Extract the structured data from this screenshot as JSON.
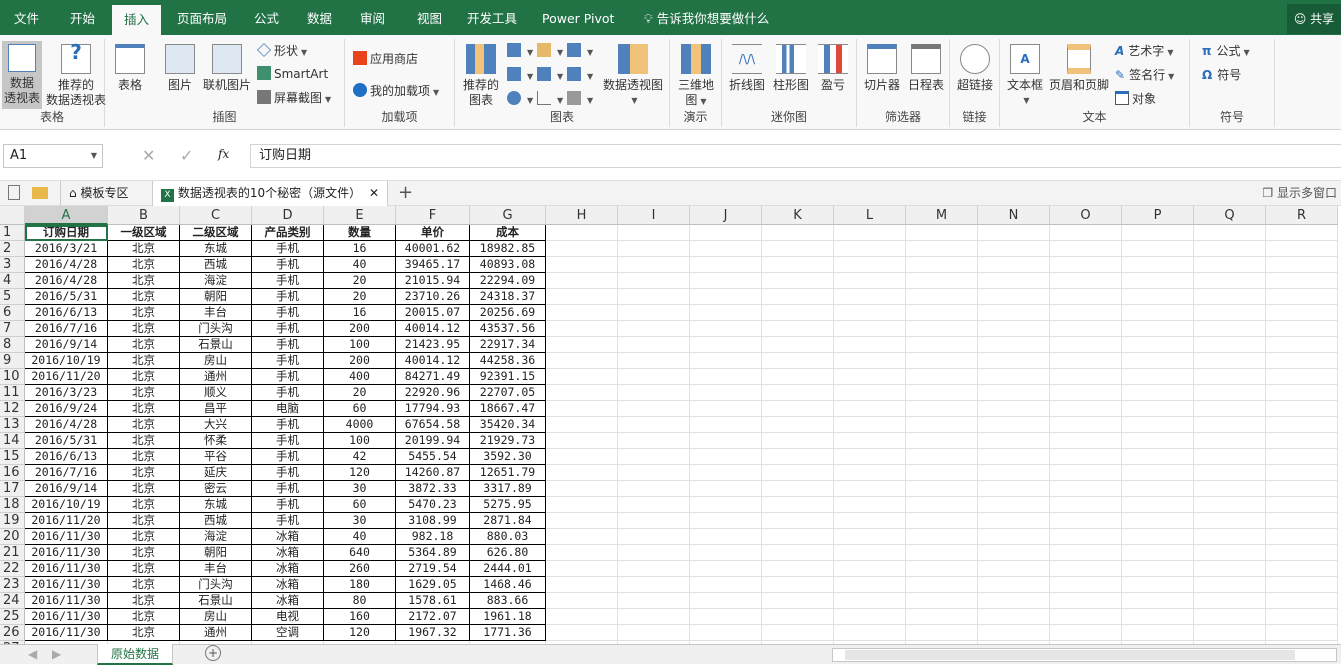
{
  "ribbon_tabs": [
    "文件",
    "开始",
    "插入",
    "页面布局",
    "公式",
    "数据",
    "审阅",
    "视图",
    "开发工具",
    "Power Pivot"
  ],
  "active_tab": "插入",
  "tell_me": "告诉我你想要做什么",
  "share": "共享",
  "groups": {
    "tables": {
      "label": "表格",
      "pivot": "数据\n透视表",
      "pivot_l1": "数据",
      "pivot_l2": "透视表",
      "rec_l1": "推荐的",
      "rec_l2": "数据透视表",
      "table": "表格"
    },
    "illustrations": {
      "label": "插图",
      "picture": "图片",
      "online_picture": "联机图片",
      "shapes": "形状",
      "smartart": "SmartArt",
      "screenshot": "屏幕截图"
    },
    "addins": {
      "label": "加载项",
      "store": "应用商店",
      "my_addins": "我的加载项"
    },
    "charts": {
      "label": "图表",
      "rec_l1": "推荐的",
      "rec_l2": "图表",
      "pivot_chart": "数据透视图"
    },
    "tours": {
      "label": "演示",
      "map_l1": "三维地",
      "map_l2": "图"
    },
    "sparklines": {
      "label": "迷你图",
      "line": "折线图",
      "column": "柱形图",
      "winloss": "盈亏"
    },
    "filters": {
      "label": "筛选器",
      "slicer": "切片器",
      "timeline": "日程表"
    },
    "links": {
      "label": "链接",
      "hyperlink": "超链接"
    },
    "text": {
      "label": "文本",
      "textbox": "文本框",
      "header_footer": "页眉和页脚",
      "wordart": "艺术字",
      "signature": "签名行",
      "object": "对象"
    },
    "symbols": {
      "label": "符号",
      "equation": "公式",
      "symbol": "符号"
    }
  },
  "formula_bar": {
    "name_box": "A1",
    "formula": "订购日期",
    "fx": "fx"
  },
  "doc_tabs": {
    "template": "模板专区",
    "file": "数据透视表的10个秘密（源文件）",
    "multi_window": "显示多窗口"
  },
  "columns": [
    "A",
    "B",
    "C",
    "D",
    "E",
    "F",
    "G",
    "H",
    "I",
    "J",
    "K",
    "L",
    "M",
    "N",
    "O",
    "P",
    "Q",
    "R"
  ],
  "table": {
    "headers": [
      "订购日期",
      "一级区域",
      "二级区域",
      "产品类别",
      "数量",
      "单价",
      "成本"
    ],
    "rows": [
      [
        "2016/3/21",
        "北京",
        "东城",
        "手机",
        "16",
        "40001.62",
        "18982.85"
      ],
      [
        "2016/4/28",
        "北京",
        "西城",
        "手机",
        "40",
        "39465.17",
        "40893.08"
      ],
      [
        "2016/4/28",
        "北京",
        "海淀",
        "手机",
        "20",
        "21015.94",
        "22294.09"
      ],
      [
        "2016/5/31",
        "北京",
        "朝阳",
        "手机",
        "20",
        "23710.26",
        "24318.37"
      ],
      [
        "2016/6/13",
        "北京",
        "丰台",
        "手机",
        "16",
        "20015.07",
        "20256.69"
      ],
      [
        "2016/7/16",
        "北京",
        "门头沟",
        "手机",
        "200",
        "40014.12",
        "43537.56"
      ],
      [
        "2016/9/14",
        "北京",
        "石景山",
        "手机",
        "100",
        "21423.95",
        "22917.34"
      ],
      [
        "2016/10/19",
        "北京",
        "房山",
        "手机",
        "200",
        "40014.12",
        "44258.36"
      ],
      [
        "2016/11/20",
        "北京",
        "通州",
        "手机",
        "400",
        "84271.49",
        "92391.15"
      ],
      [
        "2016/3/23",
        "北京",
        "顺义",
        "手机",
        "20",
        "22920.96",
        "22707.05"
      ],
      [
        "2016/9/24",
        "北京",
        "昌平",
        "电脑",
        "60",
        "17794.93",
        "18667.47"
      ],
      [
        "2016/4/28",
        "北京",
        "大兴",
        "手机",
        "4000",
        "67654.58",
        "35420.34"
      ],
      [
        "2016/5/31",
        "北京",
        "怀柔",
        "手机",
        "100",
        "20199.94",
        "21929.73"
      ],
      [
        "2016/6/13",
        "北京",
        "平谷",
        "手机",
        "42",
        "5455.54",
        "3592.30"
      ],
      [
        "2016/7/16",
        "北京",
        "延庆",
        "手机",
        "120",
        "14260.87",
        "12651.79"
      ],
      [
        "2016/9/14",
        "北京",
        "密云",
        "手机",
        "30",
        "3872.33",
        "3317.89"
      ],
      [
        "2016/10/19",
        "北京",
        "东城",
        "手机",
        "60",
        "5470.23",
        "5275.95"
      ],
      [
        "2016/11/20",
        "北京",
        "西城",
        "手机",
        "30",
        "3108.99",
        "2871.84"
      ],
      [
        "2016/11/30",
        "北京",
        "海淀",
        "冰箱",
        "40",
        "982.18",
        "880.03"
      ],
      [
        "2016/11/30",
        "北京",
        "朝阳",
        "冰箱",
        "640",
        "5364.89",
        "626.80"
      ],
      [
        "2016/11/30",
        "北京",
        "丰台",
        "冰箱",
        "260",
        "2719.54",
        "2444.01"
      ],
      [
        "2016/11/30",
        "北京",
        "门头沟",
        "冰箱",
        "180",
        "1629.05",
        "1468.46"
      ],
      [
        "2016/11/30",
        "北京",
        "石景山",
        "冰箱",
        "80",
        "1578.61",
        "883.66"
      ],
      [
        "2016/11/30",
        "北京",
        "房山",
        "电视",
        "160",
        "2172.07",
        "1961.18"
      ],
      [
        "2016/11/30",
        "北京",
        "通州",
        "空调",
        "120",
        "1967.32",
        "1771.36"
      ]
    ]
  },
  "sheet_tabs": [
    "原始数据"
  ],
  "colors": {
    "accent": "#217346"
  }
}
